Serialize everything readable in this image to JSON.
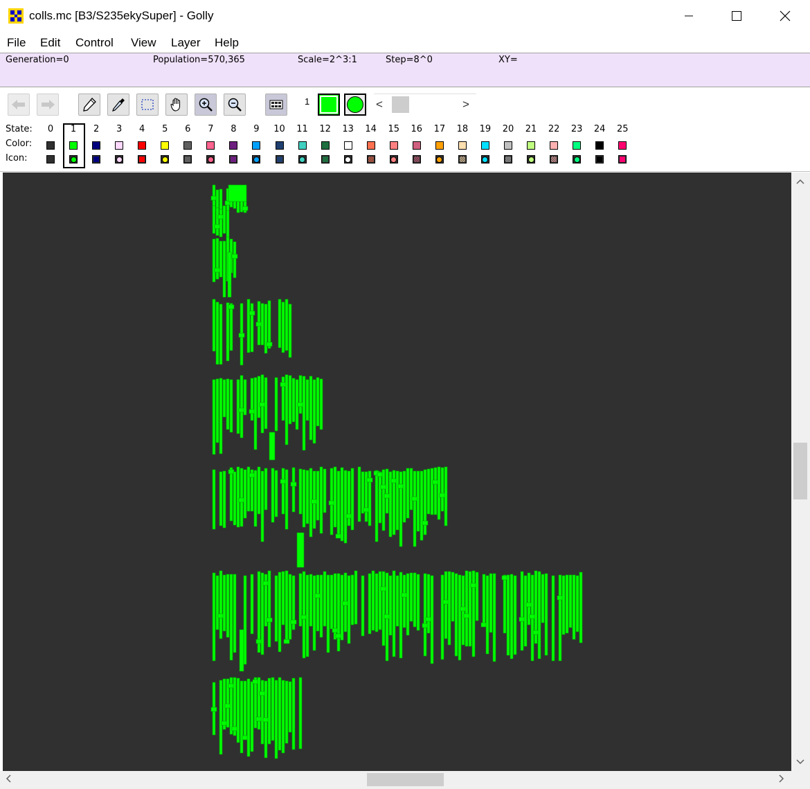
{
  "window": {
    "title": "colls.mc [B3/S235ekySuper] - Golly",
    "min_glyph": "—",
    "max_glyph": "☐",
    "close_glyph": "✕"
  },
  "menu": [
    "File",
    "Edit",
    "Control",
    "View",
    "Layer",
    "Help"
  ],
  "status": {
    "generation": "Generation=0",
    "population": "Population=570,365",
    "scale": "Scale=2^3:1",
    "step": "Step=8^0",
    "xy": "XY="
  },
  "toolbar": {
    "tools": [
      {
        "name": "undo-button",
        "icon": "arrow-left-icon",
        "enabled": false
      },
      {
        "name": "redo-button",
        "icon": "arrow-right-icon",
        "enabled": false
      },
      {
        "name": "draw-button",
        "icon": "pencil-icon",
        "enabled": true
      },
      {
        "name": "pick-button",
        "icon": "eyedropper-icon",
        "enabled": true
      },
      {
        "name": "select-button",
        "icon": "selection-icon",
        "enabled": true
      },
      {
        "name": "move-button",
        "icon": "hand-icon",
        "enabled": true
      },
      {
        "name": "zoom-in-button",
        "icon": "zoom-in-icon",
        "enabled": true
      },
      {
        "name": "zoom-out-button",
        "icon": "zoom-out-icon",
        "enabled": true
      },
      {
        "name": "all-states-button",
        "icon": "grid-icon",
        "enabled": true
      }
    ],
    "current_state": "1",
    "current_color": "#00ff00",
    "slider_left": "<",
    "slider_right": ">"
  },
  "states_panel": {
    "state_label": "State:",
    "color_label": "Color:",
    "icon_label": "Icon:",
    "selected_state": 1,
    "states": [
      {
        "n": "0",
        "color": "#303030",
        "icon": "square"
      },
      {
        "n": "1",
        "color": "#00ff00",
        "icon": "circle"
      },
      {
        "n": "2",
        "color": "#00007f",
        "icon": "square"
      },
      {
        "n": "3",
        "color": "#ffd8ff",
        "icon": "circle"
      },
      {
        "n": "4",
        "color": "#ff0000",
        "icon": "square"
      },
      {
        "n": "5",
        "color": "#ffff00",
        "icon": "circle"
      },
      {
        "n": "6",
        "color": "#606060",
        "icon": "square"
      },
      {
        "n": "7",
        "color": "#ff6490",
        "icon": "circle"
      },
      {
        "n": "8",
        "color": "#6d1f7f",
        "icon": "square"
      },
      {
        "n": "9",
        "color": "#00a0ff",
        "icon": "circle"
      },
      {
        "n": "10",
        "color": "#1f3f70",
        "icon": "square"
      },
      {
        "n": "11",
        "color": "#40d0c0",
        "icon": "circle"
      },
      {
        "n": "12",
        "color": "#1f6f40",
        "icon": "square"
      },
      {
        "n": "13",
        "color": "#ffffff",
        "icon": "circle"
      },
      {
        "n": "14",
        "color": "#ff7050",
        "icon": "checker"
      },
      {
        "n": "15",
        "color": "#ff8080",
        "icon": "circle"
      },
      {
        "n": "16",
        "color": "#d06080",
        "icon": "checker"
      },
      {
        "n": "17",
        "color": "#ffa000",
        "icon": "circle"
      },
      {
        "n": "18",
        "color": "#ffe0b0",
        "icon": "checker"
      },
      {
        "n": "19",
        "color": "#00e0ff",
        "icon": "circle"
      },
      {
        "n": "20",
        "color": "#c0c0c0",
        "icon": "checker"
      },
      {
        "n": "21",
        "color": "#c0ff80",
        "icon": "circle"
      },
      {
        "n": "22",
        "color": "#ffb0b0",
        "icon": "checker"
      },
      {
        "n": "23",
        "color": "#00ff80",
        "icon": "circle"
      },
      {
        "n": "24",
        "color": "#000000",
        "icon": "square"
      },
      {
        "n": "25",
        "color": "#ff0070",
        "icon": "square"
      }
    ]
  },
  "viewport": {
    "background": "#303030",
    "cell_color": "#00ff00"
  },
  "scrollbars": {
    "up": "▲",
    "down": "▼",
    "left": "<",
    "right": ">"
  }
}
